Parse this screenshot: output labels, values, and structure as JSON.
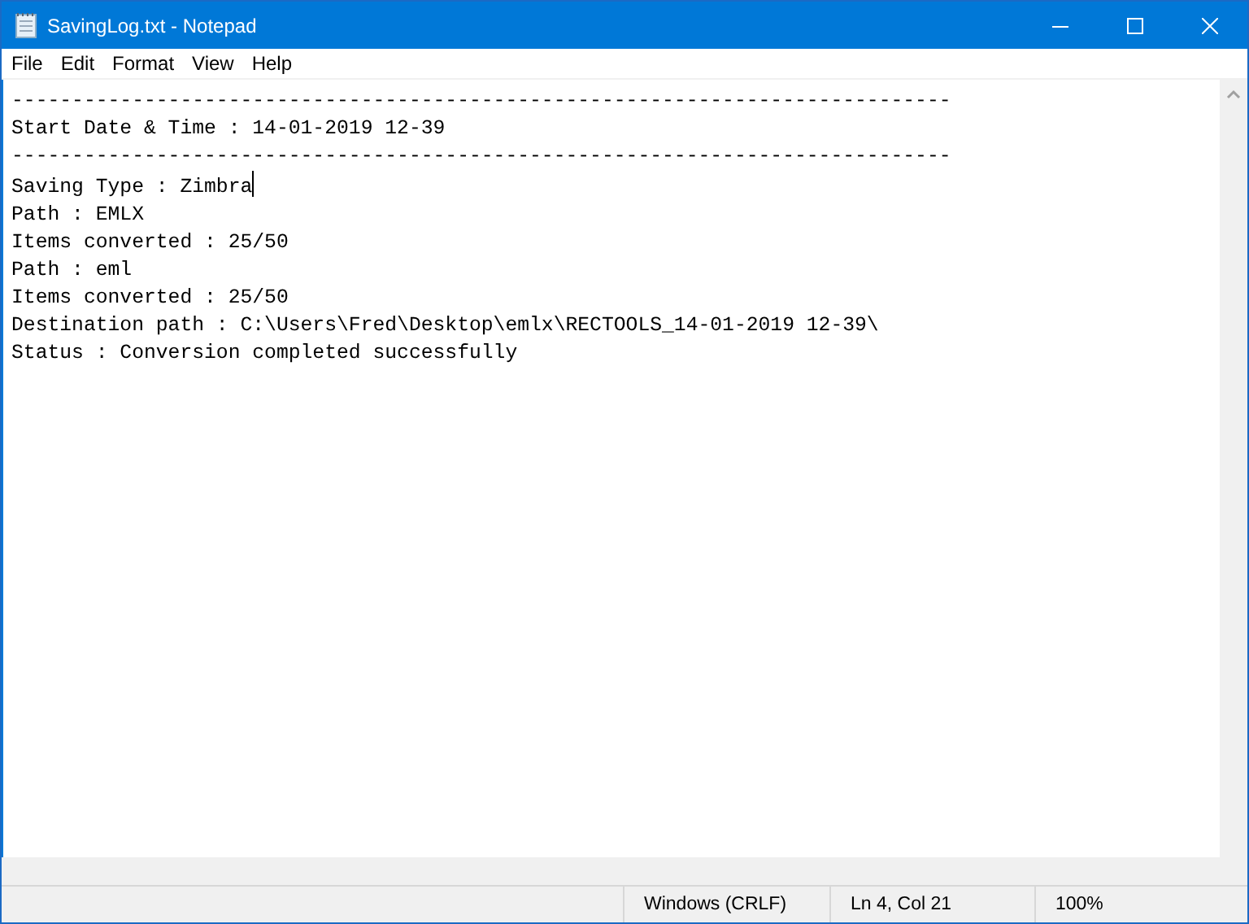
{
  "window": {
    "title": "SavingLog.txt - Notepad"
  },
  "menu": [
    "File",
    "Edit",
    "Format",
    "View",
    "Help"
  ],
  "editor": {
    "lines": [
      {
        "text": "------------------------------------------------------------------------------",
        "caret": false
      },
      {
        "text": "Start Date & Time : 14-01-2019 12-39",
        "caret": false
      },
      {
        "text": "------------------------------------------------------------------------------",
        "caret": false
      },
      {
        "text": "Saving Type : Zimbra",
        "caret": true
      },
      {
        "text": "Path : EMLX",
        "caret": false
      },
      {
        "text": "Items converted : 25/50",
        "caret": false
      },
      {
        "text": "Path : eml",
        "caret": false
      },
      {
        "text": "Items converted : 25/50",
        "caret": false
      },
      {
        "text": "Destination path : C:\\Users\\Fred\\Desktop\\emlx\\RECTOOLS_14-01-2019 12-39\\",
        "caret": false
      },
      {
        "text": "Status : Conversion completed successfully",
        "caret": false
      }
    ]
  },
  "status_bar": {
    "line_ending": "Windows (CRLF)",
    "position": "Ln 4, Col 21",
    "zoom": "100%"
  }
}
